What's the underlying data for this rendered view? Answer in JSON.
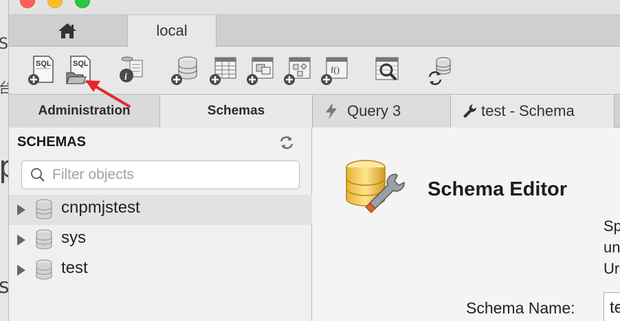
{
  "window": {
    "tabs": {
      "home_icon": "home-icon",
      "connection": "local"
    }
  },
  "background_fragments": [
    "S",
    "台",
    "p",
    "s/"
  ],
  "toolbar": {
    "icons": [
      "new-sql-tab-icon",
      "open-sql-script-icon",
      "inspector-icon",
      "create-schema-icon",
      "create-table-icon",
      "create-view-icon",
      "create-procedure-icon",
      "create-function-icon",
      "search-table-data-icon",
      "reconnect-icon"
    ],
    "sql_badge": "SQL",
    "func_badge": "f()"
  },
  "sidebar": {
    "tabs": [
      "Administration",
      "Schemas"
    ],
    "header": "SCHEMAS",
    "filter_placeholder": "Filter objects",
    "schemas": [
      "cnpmjstest",
      "sys",
      "test"
    ]
  },
  "editor": {
    "tabs": [
      {
        "label": "Query 3",
        "icon": "lightning-icon"
      },
      {
        "label": "test - Schema",
        "icon": "wrench-icon"
      }
    ],
    "title": "Schema Editor",
    "description_fragments": [
      "Sp",
      "un",
      "Ur"
    ],
    "schema_name_label": "Schema Name:",
    "schema_name_value": "te"
  },
  "colors": {
    "annotation_arrow": "#e8262a",
    "traffic_red": "#fc5f57",
    "traffic_yellow": "#fdbc2e",
    "traffic_green": "#28c840"
  }
}
